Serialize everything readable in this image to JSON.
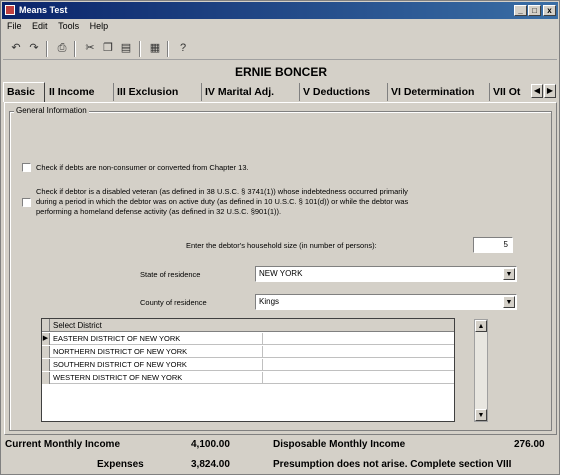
{
  "window": {
    "title": "Means Test",
    "controls": {
      "minimize": "_",
      "maximize": "□",
      "close": "x"
    }
  },
  "menu": [
    "File",
    "Edit",
    "Tools",
    "Help"
  ],
  "toolbar_icons": [
    "undo-icon",
    "redo-icon",
    "print-icon",
    "cut-icon",
    "copy-icon",
    "paste-icon",
    "calculator-icon",
    "help-icon"
  ],
  "client_name": "ERNIE BONCER",
  "tabs": [
    {
      "label": "Basic",
      "active": true
    },
    {
      "label": "II Income"
    },
    {
      "label": "III Exclusion"
    },
    {
      "label": "IV Marital Adj."
    },
    {
      "label": "V Deductions"
    },
    {
      "label": "VI Determination"
    },
    {
      "label": "VII Ot"
    }
  ],
  "group_title": "General Information",
  "checks": {
    "non_consumer": {
      "label": "Check if debts are non-consumer or converted from Chapter 13.",
      "checked": false
    },
    "disabled_veteran": {
      "label_line1": "Check if debtor is a disabled veteran (as defined in 38 U.S.C. § 3741(1)) whose indebtedness occurred primarily",
      "label_line2": "during a period in which the debtor was on active duty (as defined in 10 U.S.C. § 101(d)) or while the debtor was",
      "label_line3": "performing a homeland defense activity (as defined in 32 U.S.C. §901(1)).",
      "checked": false
    }
  },
  "household": {
    "label": "Enter the debtor's household size (in number of persons):",
    "value": "5"
  },
  "state": {
    "label": "State of residence",
    "value": "NEW YORK"
  },
  "county": {
    "label": "County of residence",
    "value": "Kings"
  },
  "district_grid": {
    "header": "Select District",
    "rows": [
      "EASTERN DISTRICT OF NEW YORK",
      "NORTHERN DISTRICT OF NEW YORK",
      "SOUTHERN DISTRICT OF NEW YORK",
      "WESTERN DISTRICT OF NEW YORK"
    ],
    "selected_index": 0
  },
  "summary": {
    "cmi_label": "Current Monthly Income",
    "cmi_value": "4,100.00",
    "dmi_label": "Disposable Monthly Income",
    "dmi_value": "276.00",
    "expenses_label": "Expenses",
    "expenses_value": "3,824.00",
    "presumption_text": "Presumption does not arise. Complete section VIII"
  }
}
